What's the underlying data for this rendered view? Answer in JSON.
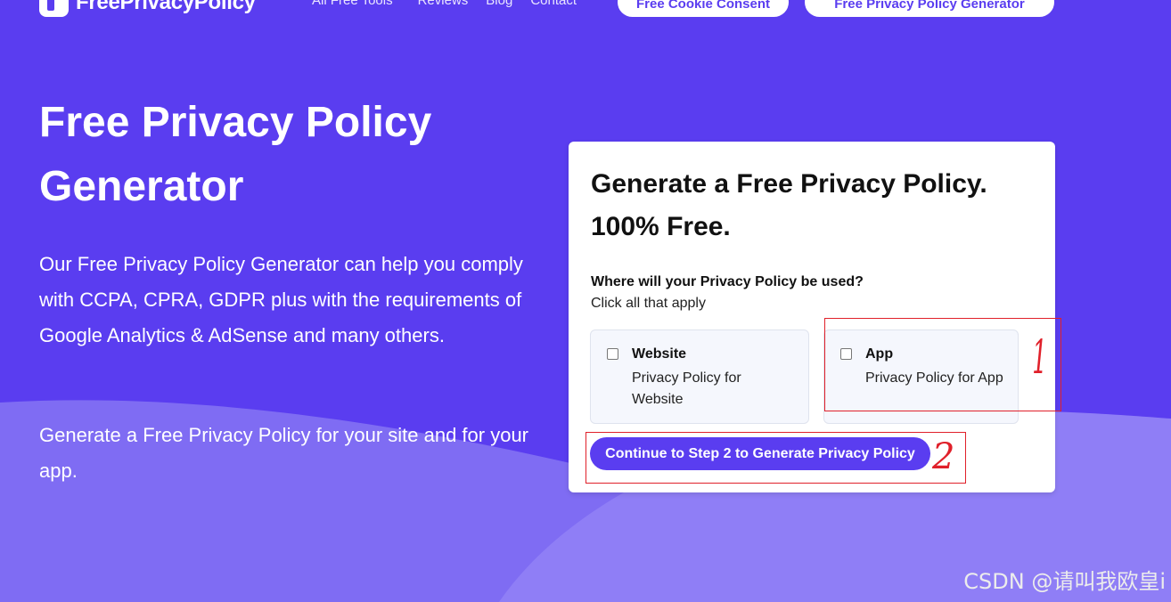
{
  "nav": {
    "logo_text": "FreePrivacyPolicy",
    "links": [
      "All Free Tools",
      "Reviews",
      "Blog",
      "Contact"
    ],
    "cookie_button": "Free Cookie Consent",
    "generator_button": "Free Privacy Policy Generator"
  },
  "hero": {
    "title": "Free Privacy Policy Generator",
    "description": "Our Free Privacy Policy Generator can help you comply with CCPA, CPRA, GDPR plus with the requirements of Google Analytics & AdSense and many others.",
    "description2": "Generate a Free Privacy Policy for your site and for your app."
  },
  "card": {
    "title": "Generate a Free Privacy Policy. 100% Free.",
    "question": "Where will your Privacy Policy be used?",
    "hint": "Click all that apply",
    "options": [
      {
        "label": "Website",
        "sub": "Privacy Policy for Website",
        "checked": false
      },
      {
        "label": "App",
        "sub": "Privacy Policy for App",
        "checked": false
      }
    ],
    "continue_button": "Continue to Step 2 to Generate Privacy Policy"
  },
  "annotations": {
    "mark_1": "1",
    "mark_2": "2",
    "color": "#e0202a"
  },
  "watermark": "CSDN @请叫我欧皇i",
  "colors": {
    "brand": "#5a3df0",
    "wave": "#8a78f5"
  }
}
